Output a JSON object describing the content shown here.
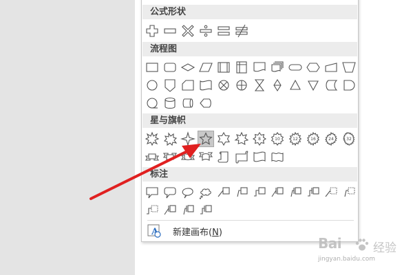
{
  "sections": {
    "formula": "公式形状",
    "flowchart": "流程图",
    "stars": "星与旗帜",
    "callouts": "标注"
  },
  "star_badges": [
    "8",
    "10",
    "12",
    "16",
    "24",
    "32"
  ],
  "new_canvas": {
    "label": "新建画布",
    "hotkey_open": "(",
    "hotkey": "N",
    "hotkey_close": ")"
  },
  "selected_shape": "star-5-point-icon",
  "annotation": {
    "arrow_color": "#e02020"
  },
  "watermark": {
    "brand_left": "Bai",
    "brand_right": "经验",
    "url": "jingyan.baidu.com"
  }
}
